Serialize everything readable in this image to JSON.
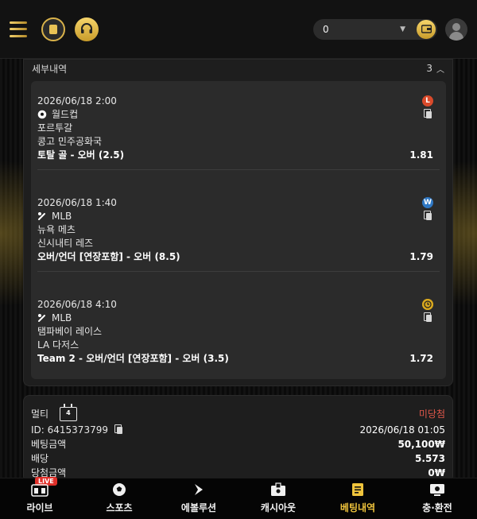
{
  "header": {
    "balance_value": "0",
    "icons": [
      "menu-icon",
      "coin-icon",
      "support-icon",
      "wallet-icon",
      "user-icon"
    ]
  },
  "detail": {
    "title": "세부내역",
    "count": "3",
    "legs": [
      {
        "date": "2026/06/18 2:00",
        "status": "L",
        "status_meaning": "lose",
        "sport_icon": "soccer-ball-icon",
        "league": "월드컵",
        "team1": "포르투갈",
        "team2": "콩고 민주공화국",
        "bet": "토탈 골 - 오버 (2.5)",
        "odds": "1.81"
      },
      {
        "date": "2026/06/18 1:40",
        "status": "W",
        "status_meaning": "win",
        "sport_icon": "baseball-icon",
        "league": "MLB",
        "team1": "뉴욕 메츠",
        "team2": "신시내티 레즈",
        "bet": "오버/언더 [연장포함] - 오버 (8.5)",
        "odds": "1.79"
      },
      {
        "date": "2026/06/18 4:10",
        "status": "clock",
        "status_meaning": "pending",
        "sport_icon": "baseball-icon",
        "league": "MLB",
        "team1": "탬파베이 레이스",
        "team2": "LA 다저스",
        "bet": "Team 2 - 오버/언더 [연장포함] - 오버 (3.5)",
        "odds": "1.72"
      }
    ]
  },
  "summary": {
    "type_label": "멀티",
    "type_badge": "4",
    "result": "미당첨",
    "id_label": "ID: 6415373799",
    "datetime": "2026/06/18 01:05",
    "stake_label": "베팅금액",
    "stake_value": "50,100₩",
    "odds_label": "배당",
    "odds_value": "5.573",
    "payout_label": "당첨금액",
    "payout_value": "0₩"
  },
  "nav": {
    "live_badge": "LIVE",
    "items": [
      {
        "label": "라이브",
        "icon": "live-scoreboard-icon"
      },
      {
        "label": "스포츠",
        "icon": "soccer-ball-icon"
      },
      {
        "label": "에볼루션",
        "icon": "evolution-icon"
      },
      {
        "label": "캐시아웃",
        "icon": "cashout-icon"
      },
      {
        "label": "베팅내역",
        "icon": "bet-history-icon",
        "active": true
      },
      {
        "label": "충·환전",
        "icon": "deposit-withdraw-icon"
      }
    ]
  },
  "colors": {
    "accent": "#f0c43c",
    "lose": "#d94a2b",
    "win": "#2f78c4",
    "pending": "#d9a81e",
    "result_red": "#e0574a"
  }
}
